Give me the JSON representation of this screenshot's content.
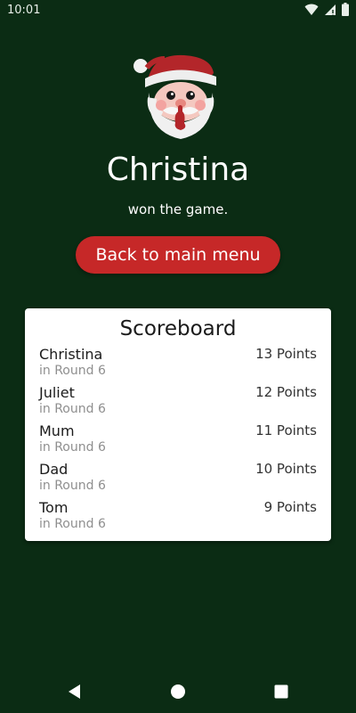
{
  "status_bar": {
    "time": "10:01"
  },
  "winner": {
    "name": "Christina",
    "subtitle": "won the game."
  },
  "actions": {
    "back_label": "Back to main menu"
  },
  "scoreboard": {
    "title": "Scoreboard",
    "rows": [
      {
        "name": "Christina",
        "round": "in Round 6",
        "points": "13 Points"
      },
      {
        "name": "Juliet",
        "round": "in Round 6",
        "points": "12 Points"
      },
      {
        "name": "Mum",
        "round": "in Round 6",
        "points": "11 Points"
      },
      {
        "name": "Dad",
        "round": "in Round 6",
        "points": "10 Points"
      },
      {
        "name": "Tom",
        "round": "in Round 6",
        "points": "9 Points"
      }
    ]
  },
  "colors": {
    "background": "#0b2c14",
    "accent": "#c62828",
    "card": "#ffffff"
  },
  "icons": [
    "wifi-icon",
    "signal-icon",
    "battery-icon",
    "santa-avatar-icon",
    "back-nav-icon",
    "home-nav-icon",
    "recents-nav-icon"
  ]
}
